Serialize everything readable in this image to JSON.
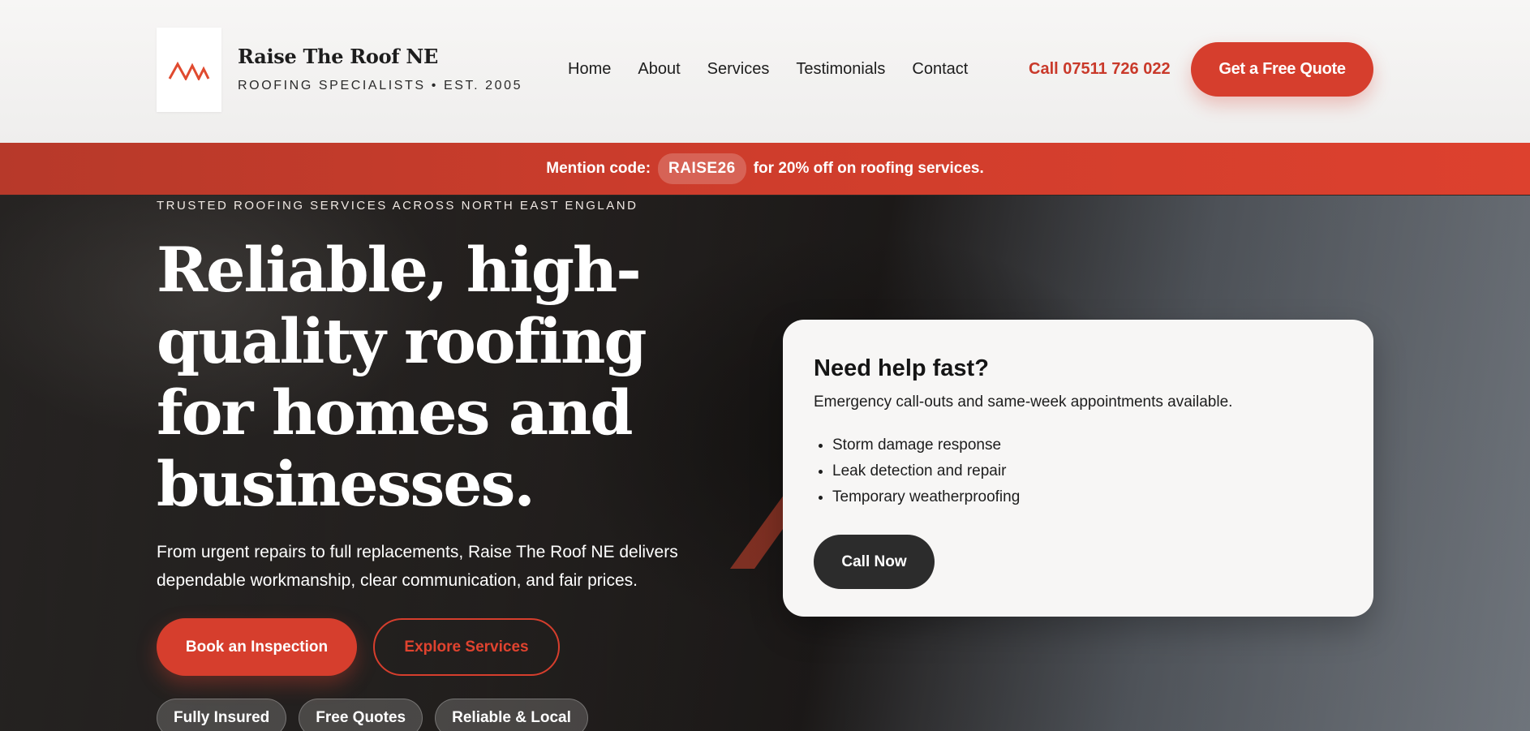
{
  "brand": {
    "name": "Raise The Roof NE",
    "tagline": "ROOFING SPECIALISTS • EST. 2005",
    "logo_icon": "roof-peaks-icon"
  },
  "nav": {
    "items": [
      {
        "label": "Home"
      },
      {
        "label": "About"
      },
      {
        "label": "Services"
      },
      {
        "label": "Testimonials"
      },
      {
        "label": "Contact"
      }
    ],
    "call_label": "Call 07511 726 022",
    "quote_label": "Get a Free Quote"
  },
  "promo": {
    "prefix": "Mention code:",
    "code": "RAISE26",
    "suffix": "for 20% off on roofing services."
  },
  "hero": {
    "eyebrow": "TRUSTED ROOFING SERVICES ACROSS NORTH EAST ENGLAND",
    "headline": "Reliable, high-quality roofing for homes and businesses.",
    "lede": "From urgent repairs to full replacements, Raise The Roof NE delivers dependable workmanship, clear communication, and fair prices.",
    "primary_cta": "Book an Inspection",
    "secondary_cta": "Explore Services",
    "chips": [
      "Fully Insured",
      "Free Quotes",
      "Reliable & Local"
    ]
  },
  "help_card": {
    "title": "Need help fast?",
    "subtitle": "Emergency call-outs and same-week appointments available.",
    "items": [
      "Storm damage response",
      "Leak detection and repair",
      "Temporary weatherproofing"
    ],
    "cta": "Call Now"
  },
  "colors": {
    "accent": "#d63e2d",
    "dark": "#2c2c2c",
    "header_bg": "#f4f3f2"
  }
}
